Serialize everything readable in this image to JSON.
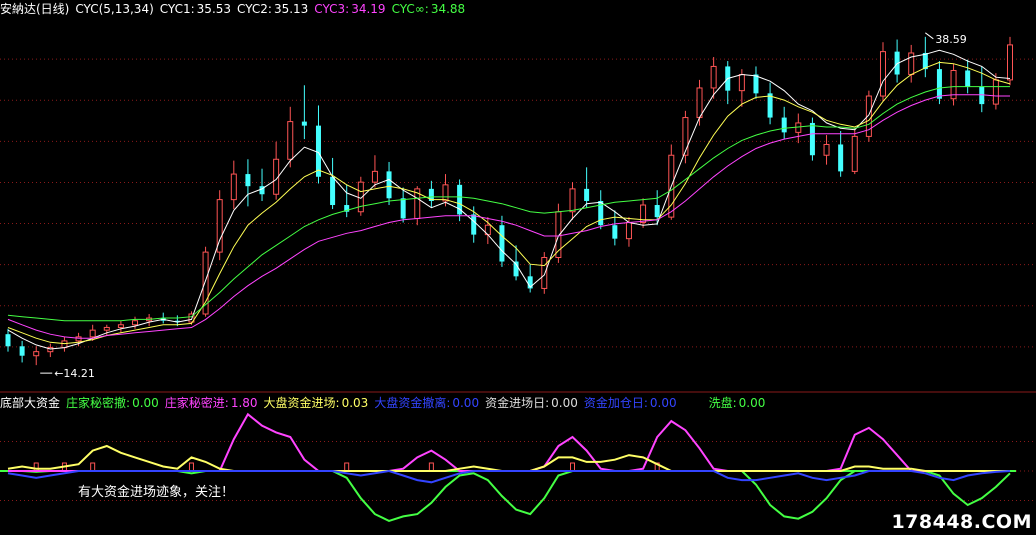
{
  "header": {
    "title": "安納达(日线)",
    "indicator": "CYC(5,13,34)",
    "items": [
      {
        "label": "CYC1:",
        "value": "35.53",
        "color": "#ffffff"
      },
      {
        "label": "CYC2:",
        "value": "35.13",
        "color": "#ffff55"
      },
      {
        "label": "CYC3:",
        "value": "34.19",
        "color": "#ff44ff"
      },
      {
        "label": "CYC∞:",
        "value": "34.88",
        "color": "#44ff44"
      }
    ]
  },
  "lower_header": {
    "title": "底部大资金",
    "items": [
      {
        "label": "庄家秘密撤:",
        "value": "0.00",
        "color": "#44ff44"
      },
      {
        "label": "庄家秘密进:",
        "value": "1.80",
        "color": "#ff44ff"
      },
      {
        "label": "大盘资金进场:",
        "value": "0.03",
        "color": "#ffff66"
      },
      {
        "label": "大盘资金撤离:",
        "value": "0.00",
        "color": "#3344ff"
      },
      {
        "label": "资金进场日:",
        "value": "0.00",
        "color": "#dddddd"
      },
      {
        "label": "资金加仓日:",
        "value": "0.00",
        "color": "#3344ff"
      },
      {
        "label": "洗盘:",
        "value": "0.00",
        "color": "#44ff44"
      }
    ]
  },
  "annotations": {
    "high_label": "38.59",
    "low_label": "14.21",
    "lower_note": "有大资金进场迹象，关注！"
  },
  "watermark": "178448.COM",
  "colors": {
    "up": "#ff5555",
    "down": "#44ffff",
    "cyc1": "#ffffff",
    "cyc2": "#ffff55",
    "cyc3": "#ff44ff",
    "cycinf": "#44ff44",
    "grid": "#8a1a1a"
  },
  "chart_data": [
    {
      "type": "candlestick",
      "title": "安納达(日线)",
      "ylim": [
        12.5,
        40
      ],
      "series": [
        {
          "name": "CYC1",
          "values": [
            16.8,
            16.2,
            15.7,
            15.4,
            15.5,
            15.8,
            16.2,
            16.6,
            16.9,
            17.1,
            17.4,
            17.6,
            17.4,
            17.6,
            20.5,
            23.5,
            25.7,
            26.9,
            27.3,
            28.0,
            29.4,
            30.4,
            30.0,
            28.2,
            27.0,
            26.6,
            27.6,
            28.0,
            27.2,
            26.6,
            25.9,
            26.3,
            25.8,
            24.9,
            23.9,
            22.7,
            21.7,
            20.0,
            20.9,
            23.8,
            25.1,
            26.2,
            26.3,
            25.6,
            24.8,
            24.6,
            24.7,
            27.5,
            30.1,
            32.6,
            34.3,
            35.5,
            35.8,
            35.7,
            35.3,
            34.6,
            33.6,
            33.1,
            32.2,
            31.8,
            31.7,
            32.8,
            35.3,
            36.6,
            37.1,
            37.3,
            37.6,
            37.3,
            36.8,
            36.4,
            35.6,
            35.5
          ]
        },
        {
          "name": "CYC2",
          "values": [
            17.0,
            16.6,
            16.2,
            15.9,
            15.8,
            15.9,
            16.1,
            16.4,
            16.6,
            16.8,
            17.0,
            17.2,
            17.2,
            17.3,
            18.9,
            21.0,
            23.0,
            24.6,
            25.5,
            26.3,
            27.3,
            28.2,
            28.7,
            28.3,
            27.6,
            27.1,
            27.3,
            27.5,
            27.3,
            27.0,
            26.5,
            26.5,
            26.2,
            25.6,
            24.8,
            23.8,
            22.9,
            21.7,
            21.6,
            22.7,
            23.6,
            24.5,
            25.0,
            25.2,
            25.1,
            25.0,
            25.0,
            26.1,
            27.7,
            29.6,
            31.3,
            32.7,
            33.6,
            34.1,
            34.2,
            33.9,
            33.4,
            33.0,
            32.4,
            32.1,
            31.9,
            32.4,
            33.8,
            35.0,
            35.8,
            36.3,
            36.7,
            36.6,
            36.3,
            35.9,
            35.4,
            35.1
          ]
        },
        {
          "name": "CYC3",
          "values": [
            17.6,
            17.2,
            16.8,
            16.5,
            16.3,
            16.2,
            16.2,
            16.4,
            16.5,
            16.6,
            16.7,
            16.8,
            16.9,
            17.0,
            17.6,
            18.4,
            19.3,
            20.1,
            20.8,
            21.4,
            22.1,
            22.8,
            23.4,
            23.7,
            24.0,
            24.2,
            24.5,
            24.8,
            25.0,
            25.1,
            25.2,
            25.3,
            25.3,
            25.3,
            25.1,
            24.9,
            24.6,
            24.2,
            23.8,
            23.8,
            24.0,
            24.2,
            24.5,
            24.7,
            24.8,
            24.9,
            25.0,
            25.6,
            26.4,
            27.3,
            28.2,
            29.0,
            29.7,
            30.3,
            30.7,
            31.0,
            31.2,
            31.4,
            31.4,
            31.4,
            31.4,
            31.7,
            32.4,
            33.0,
            33.5,
            33.9,
            34.2,
            34.3,
            34.3,
            34.3,
            34.2,
            34.2
          ]
        },
        {
          "name": "CYC∞",
          "values": [
            17.9,
            17.8,
            17.7,
            17.6,
            17.5,
            17.5,
            17.5,
            17.5,
            17.5,
            17.6,
            17.6,
            17.7,
            17.7,
            17.8,
            18.7,
            19.6,
            20.6,
            21.5,
            22.4,
            23.1,
            23.8,
            24.5,
            25.0,
            25.4,
            25.7,
            26.0,
            26.2,
            26.4,
            26.5,
            26.6,
            26.7,
            26.7,
            26.7,
            26.6,
            26.4,
            26.2,
            25.9,
            25.6,
            25.5,
            25.6,
            25.7,
            25.9,
            26.1,
            26.3,
            26.4,
            26.5,
            26.6,
            27.2,
            28.0,
            28.8,
            29.6,
            30.3,
            30.9,
            31.3,
            31.6,
            31.8,
            31.9,
            32.0,
            31.9,
            31.9,
            31.8,
            32.1,
            32.9,
            33.6,
            34.1,
            34.5,
            34.8,
            34.9,
            34.9,
            34.9,
            34.9,
            34.9
          ]
        }
      ],
      "ohlc": [
        [
          16.5,
          16.9,
          15.2,
          15.6
        ],
        [
          15.6,
          16.0,
          14.4,
          14.9
        ],
        [
          14.9,
          15.6,
          14.2,
          15.2
        ],
        [
          15.2,
          15.8,
          14.8,
          15.5
        ],
        [
          15.5,
          16.3,
          15.2,
          16.0
        ],
        [
          16.0,
          16.6,
          15.6,
          16.3
        ],
        [
          16.3,
          17.2,
          16.0,
          16.8
        ],
        [
          16.8,
          17.2,
          16.4,
          17.0
        ],
        [
          17.0,
          17.5,
          16.6,
          17.2
        ],
        [
          17.2,
          17.8,
          16.9,
          17.5
        ],
        [
          17.5,
          18.0,
          17.1,
          17.7
        ],
        [
          17.7,
          18.1,
          17.3,
          17.5
        ],
        [
          17.5,
          17.9,
          17.1,
          17.4
        ],
        [
          17.4,
          18.2,
          17.2,
          18.0
        ],
        [
          18.0,
          23.0,
          17.8,
          22.6
        ],
        [
          22.6,
          27.2,
          22.0,
          26.5
        ],
        [
          26.5,
          29.4,
          25.8,
          28.4
        ],
        [
          28.4,
          29.5,
          26.0,
          27.5
        ],
        [
          27.5,
          28.8,
          26.4,
          26.9
        ],
        [
          26.9,
          30.8,
          26.5,
          29.5
        ],
        [
          29.5,
          33.4,
          28.9,
          32.3
        ],
        [
          32.3,
          35.0,
          31.0,
          32.0
        ],
        [
          32.0,
          33.5,
          27.7,
          28.2
        ],
        [
          28.2,
          29.6,
          25.8,
          26.1
        ],
        [
          26.1,
          27.6,
          25.2,
          25.6
        ],
        [
          25.6,
          28.2,
          25.3,
          27.8
        ],
        [
          27.8,
          29.8,
          27.4,
          28.6
        ],
        [
          28.6,
          29.3,
          26.1,
          26.6
        ],
        [
          26.6,
          27.4,
          24.8,
          25.1
        ],
        [
          25.1,
          27.5,
          24.6,
          27.3
        ],
        [
          27.3,
          27.9,
          25.9,
          26.4
        ],
        [
          26.4,
          28.4,
          26.0,
          27.6
        ],
        [
          27.6,
          28.0,
          24.9,
          25.4
        ],
        [
          25.4,
          26.0,
          23.3,
          23.9
        ],
        [
          23.9,
          25.2,
          23.2,
          24.6
        ],
        [
          24.6,
          25.3,
          21.5,
          21.9
        ],
        [
          21.9,
          23.1,
          20.5,
          20.8
        ],
        [
          20.8,
          21.7,
          19.6,
          19.9
        ],
        [
          19.9,
          22.6,
          19.5,
          22.2
        ],
        [
          22.2,
          26.2,
          21.8,
          25.6
        ],
        [
          25.6,
          27.8,
          25.0,
          27.3
        ],
        [
          27.3,
          28.9,
          25.9,
          26.4
        ],
        [
          26.4,
          27.2,
          24.3,
          24.6
        ],
        [
          24.6,
          25.7,
          23.1,
          23.6
        ],
        [
          23.6,
          25.2,
          23.0,
          24.8
        ],
        [
          24.8,
          26.6,
          24.4,
          26.1
        ],
        [
          26.1,
          27.2,
          24.6,
          25.2
        ],
        [
          25.2,
          30.6,
          25.0,
          29.8
        ],
        [
          29.8,
          33.1,
          29.2,
          32.6
        ],
        [
          32.6,
          35.4,
          32.0,
          34.8
        ],
        [
          34.8,
          37.1,
          34.0,
          36.4
        ],
        [
          36.4,
          36.8,
          33.6,
          34.6
        ],
        [
          34.6,
          36.2,
          33.4,
          35.8
        ],
        [
          35.8,
          36.4,
          34.0,
          34.4
        ],
        [
          34.4,
          35.2,
          32.1,
          32.6
        ],
        [
          32.6,
          33.4,
          31.0,
          31.5
        ],
        [
          31.5,
          32.9,
          30.7,
          32.2
        ],
        [
          32.2,
          32.6,
          29.4,
          29.8
        ],
        [
          29.8,
          31.3,
          29.1,
          30.6
        ],
        [
          30.6,
          31.6,
          28.2,
          28.6
        ],
        [
          28.6,
          31.8,
          28.4,
          31.2
        ],
        [
          31.2,
          34.6,
          30.8,
          34.2
        ],
        [
          34.2,
          38.2,
          33.8,
          37.5
        ],
        [
          37.5,
          38.4,
          35.2,
          35.8
        ],
        [
          35.8,
          38.0,
          35.2,
          37.4
        ],
        [
          37.4,
          38.6,
          35.6,
          36.2
        ],
        [
          36.2,
          36.8,
          33.6,
          34.0
        ],
        [
          34.0,
          36.6,
          33.5,
          36.1
        ],
        [
          36.1,
          36.9,
          34.4,
          34.9
        ],
        [
          34.9,
          36.4,
          33.0,
          33.6
        ],
        [
          33.6,
          35.9,
          33.2,
          35.4
        ],
        [
          35.4,
          38.6,
          35.0,
          38.0
        ]
      ]
    },
    {
      "type": "line",
      "title": "底部大资金",
      "ylim": [
        -1.3,
        1.3
      ],
      "series": [
        {
          "name": "庄家秘密撤",
          "values": [
            0,
            0,
            -0.02,
            0,
            0,
            0,
            0,
            0,
            0,
            0,
            0,
            0,
            0,
            -0.05,
            0,
            0,
            0,
            0,
            0,
            0,
            0,
            0,
            0,
            0,
            -0.15,
            -0.6,
            -0.95,
            -1.1,
            -1.0,
            -0.95,
            -0.7,
            -0.35,
            -0.1,
            -0.05,
            -0.2,
            -0.55,
            -0.85,
            -0.95,
            -0.6,
            -0.1,
            0,
            0,
            0,
            0,
            0,
            0,
            0,
            0,
            0,
            0,
            0,
            0,
            0,
            -0.3,
            -0.75,
            -1.0,
            -1.05,
            -0.9,
            -0.6,
            -0.2,
            0,
            0,
            0,
            0,
            0,
            0,
            -0.1,
            -0.5,
            -0.75,
            -0.6,
            -0.35,
            -0.05
          ]
        },
        {
          "name": "庄家秘密进",
          "values": [
            0,
            0,
            0,
            0,
            0,
            0,
            0,
            0,
            0,
            0,
            0,
            0,
            0,
            0,
            0,
            0,
            0.7,
            1.25,
            1.0,
            0.85,
            0.75,
            0.25,
            0,
            0,
            0,
            0,
            0,
            0,
            0.05,
            0.3,
            0.45,
            0.25,
            0,
            0,
            0,
            0,
            0,
            0,
            0.1,
            0.55,
            0.75,
            0.45,
            0.05,
            0,
            0,
            0.05,
            0.75,
            1.1,
            0.9,
            0.5,
            0.05,
            0,
            0,
            0,
            0,
            0,
            0,
            0,
            0,
            0.05,
            0.8,
            0.95,
            0.7,
            0.35,
            0,
            0,
            0,
            0,
            0,
            0,
            0,
            0
          ]
        },
        {
          "name": "大盘资金进场",
          "values": [
            0.05,
            0.1,
            0.05,
            0.05,
            0.1,
            0.15,
            0.45,
            0.55,
            0.4,
            0.3,
            0.2,
            0.1,
            0.05,
            0.3,
            0.2,
            0.05,
            0,
            0,
            0,
            0,
            0,
            0,
            0,
            0,
            0,
            0,
            0,
            0,
            0,
            0,
            0,
            0,
            0.05,
            0.1,
            0.05,
            0,
            0,
            0,
            0.1,
            0.3,
            0.3,
            0.2,
            0.2,
            0.25,
            0.35,
            0.3,
            0.15,
            0,
            0,
            0,
            0,
            0,
            0,
            0,
            0,
            0,
            0,
            0,
            0,
            0,
            0.1,
            0.1,
            0.05,
            0.05,
            0.05,
            0,
            0,
            0,
            0,
            0,
            0,
            0
          ]
        },
        {
          "name": "大盘资金撤离",
          "values": [
            -0.05,
            -0.1,
            -0.15,
            -0.1,
            -0.05,
            0,
            0,
            0,
            0,
            0,
            0,
            0,
            0,
            0,
            0,
            0,
            0,
            0,
            0,
            0,
            0,
            0,
            0,
            0,
            -0.05,
            -0.1,
            -0.05,
            0,
            -0.1,
            -0.2,
            -0.25,
            -0.15,
            -0.05,
            0,
            0,
            0,
            0,
            0,
            0,
            0,
            0,
            0,
            0,
            0,
            0,
            0,
            0,
            0,
            0,
            0,
            0,
            -0.15,
            -0.2,
            -0.2,
            -0.15,
            -0.1,
            -0.05,
            -0.15,
            -0.2,
            -0.15,
            -0.1,
            0,
            0,
            0,
            0,
            -0.05,
            -0.15,
            -0.2,
            -0.1,
            -0.05,
            -0.02,
            0
          ]
        }
      ]
    }
  ]
}
